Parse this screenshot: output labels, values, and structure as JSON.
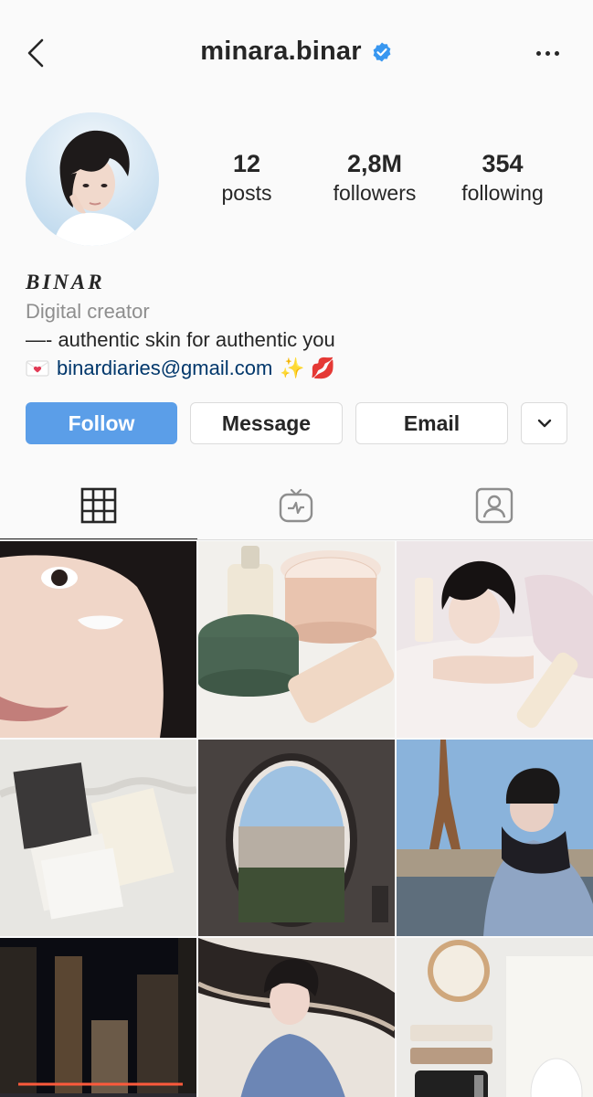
{
  "header": {
    "username": "minara.binar"
  },
  "stats": [
    {
      "value": "12",
      "label": "posts"
    },
    {
      "value": "2,8M",
      "label": "followers"
    },
    {
      "value": "354",
      "label": "following"
    }
  ],
  "bio": {
    "display_name": "BINAR",
    "category": "Digital creator",
    "line1": "—- authentic skin for authentic you",
    "email": "binardiaries@gmail.com",
    "trailing_emojis": "✨ 💋"
  },
  "actions": {
    "follow": "Follow",
    "message": "Message",
    "email": "Email"
  },
  "tabs": [
    "grid-icon",
    "igtv-icon",
    "tagged-icon"
  ],
  "colors": {
    "follow_blue": "#5b9ee8",
    "verified_blue": "#3897f0",
    "link": "#00376b"
  }
}
